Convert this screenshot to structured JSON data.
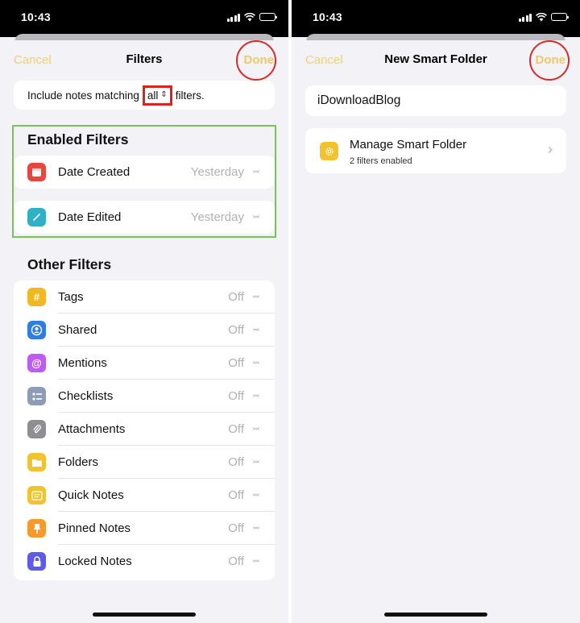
{
  "left_screen": {
    "status_time": "10:43",
    "nav": {
      "cancel_label": "Cancel",
      "title": "Filters",
      "done_label": "Done"
    },
    "match": {
      "prefix": "Include notes matching",
      "selected": "all",
      "suffix": "filters."
    },
    "enabled_section": {
      "title": "Enabled Filters",
      "items": [
        {
          "label": "Date Created",
          "value": "Yesterday",
          "icon": "calendar-icon",
          "color": "#e8453c"
        },
        {
          "label": "Date Edited",
          "value": "Yesterday",
          "icon": "pencil-icon",
          "color": "#30b0c7"
        }
      ]
    },
    "other_section": {
      "title": "Other Filters",
      "items": [
        {
          "label": "Tags",
          "value": "Off",
          "icon": "hashtag-icon",
          "color": "#f2b824"
        },
        {
          "label": "Shared",
          "value": "Off",
          "icon": "shared-people-icon",
          "color": "#2f7de1"
        },
        {
          "label": "Mentions",
          "value": "Off",
          "icon": "at-sign-icon",
          "color": "#bf5af2"
        },
        {
          "label": "Checklists",
          "value": "Off",
          "icon": "checklist-icon",
          "color": "#8e9db5"
        },
        {
          "label": "Attachments",
          "value": "Off",
          "icon": "paperclip-icon",
          "color": "#8e8e93"
        },
        {
          "label": "Folders",
          "value": "Off",
          "icon": "folder-icon",
          "color": "#f2c32f"
        },
        {
          "label": "Quick Notes",
          "value": "Off",
          "icon": "quick-note-icon",
          "color": "#f2c32f"
        },
        {
          "label": "Pinned Notes",
          "value": "Off",
          "icon": "pin-icon",
          "color": "#f79a2e"
        },
        {
          "label": "Locked Notes",
          "value": "Off",
          "icon": "lock-icon",
          "color": "#5e5ce6"
        }
      ]
    }
  },
  "right_screen": {
    "status_time": "10:43",
    "nav": {
      "cancel_label": "Cancel",
      "title": "New Smart Folder",
      "done_label": "Done"
    },
    "folder_name": "iDownloadBlog",
    "manage": {
      "title": "Manage Smart Folder",
      "subtitle": "2 filters enabled",
      "icon": "gear-icon",
      "color": "#f2c32f"
    }
  },
  "colors": {
    "accent": "#e8b422",
    "highlight_red": "#d62b2b",
    "highlight_green": "#7cc15e",
    "background": "#f2f2f7"
  }
}
